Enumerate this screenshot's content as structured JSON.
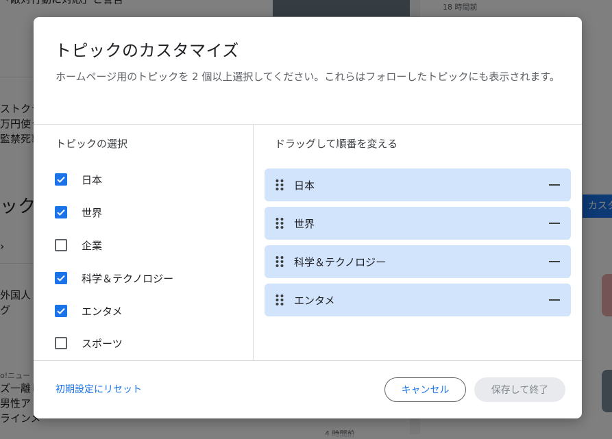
{
  "background": {
    "left_snippets": [
      "「敵対行動に対応」と警告",
      "ストクラ",
      "万円使う",
      "監禁死事",
      "ック",
      "外国人",
      "グ",
      "o!ニュー",
      "ズ一離し",
      "男性ア",
      "ラインメ"
    ],
    "right_snippets": [
      "18 時間前",
      "カスタ",
      "4 時間前"
    ]
  },
  "dialog": {
    "title": "トピックのカスタマイズ",
    "description": "ホームページ用のトピックを 2 個以上選択してください。これらはフォローしたトピックにも表示されます。",
    "select_label": "トピックの選択",
    "drag_label": "ドラッグして順番を変える",
    "topics": [
      {
        "label": "日本",
        "checked": true
      },
      {
        "label": "世界",
        "checked": true
      },
      {
        "label": "企業",
        "checked": false
      },
      {
        "label": "科学＆テクノロジー",
        "checked": true
      },
      {
        "label": "エンタメ",
        "checked": true
      },
      {
        "label": "スポーツ",
        "checked": false
      }
    ],
    "ordered": [
      "日本",
      "世界",
      "科学＆テクノロジー",
      "エンタメ"
    ],
    "reset_label": "初期設定にリセット",
    "cancel_label": "キャンセル",
    "save_label": "保存して終了"
  },
  "colors": {
    "accent": "#1a73e8",
    "chip_bg": "#d2e3fc",
    "disabled_bg": "#e8eaed"
  }
}
